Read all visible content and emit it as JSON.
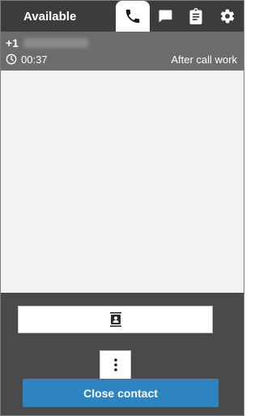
{
  "header": {
    "status_label": "Available",
    "tabs": [
      {
        "name": "phone",
        "icon": "phone-icon",
        "active": true
      },
      {
        "name": "chat",
        "icon": "chat-icon",
        "active": false
      },
      {
        "name": "tasks",
        "icon": "clipboard-icon",
        "active": false
      },
      {
        "name": "settings",
        "icon": "gear-icon",
        "active": false
      }
    ]
  },
  "contact": {
    "phone_prefix": "+1",
    "timer": "00:37",
    "state": "After call work"
  },
  "actions": {
    "quick_connect_icon": "contact-card-icon",
    "more_icon": "vertical-dots-icon",
    "close_label": "Close contact"
  },
  "colors": {
    "accent": "#2d84c1",
    "header_bg": "#3c3c3c",
    "contact_bg": "#6c6c6c",
    "panel_bg": "#4a4a4a"
  }
}
